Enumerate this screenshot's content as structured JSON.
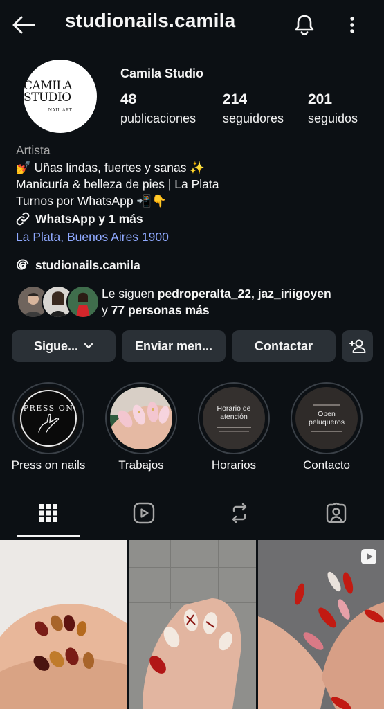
{
  "header": {
    "username": "studionails.camila"
  },
  "profile": {
    "avatar_line1": "CAMILA STUDIO",
    "avatar_line2": "NAIL ART",
    "name": "Camila Studio",
    "stats": [
      {
        "value": "48",
        "label": "publicaciones"
      },
      {
        "value": "214",
        "label": "seguidores"
      },
      {
        "value": "201",
        "label": "seguidos"
      }
    ],
    "category": "Artista",
    "bio_line1": "💅 Uñas lindas, fuertes y sanas ✨",
    "bio_line2": "Manicuría & belleza de pies | La Plata",
    "bio_line3": "Turnos por WhatsApp 📲👇",
    "link_text": "WhatsApp y 1 más",
    "location": "La Plata, Buenos Aires 1900",
    "threads_handle": "studionails.camila",
    "followed_by_prefix": "Le siguen ",
    "followed_by_users": "pedroperalta_22, jaz_iriigoyen",
    "followed_by_and": "y ",
    "followed_by_others": "77 personas más"
  },
  "buttons": {
    "following": "Sigue...",
    "message": "Enviar men...",
    "contact": "Contactar"
  },
  "highlights": [
    {
      "label": "Press on nails",
      "cover_text": "PRESS ON"
    },
    {
      "label": "Trabajos"
    },
    {
      "label": "Horarios",
      "cover_text": "Horario de atención"
    },
    {
      "label": "Contacto",
      "cover_text": "Open peluqueros"
    }
  ],
  "colors": {
    "background": "#0c1014",
    "button": "#2a3036",
    "link": "#8fa9ff",
    "muted": "#a8a8a8"
  }
}
